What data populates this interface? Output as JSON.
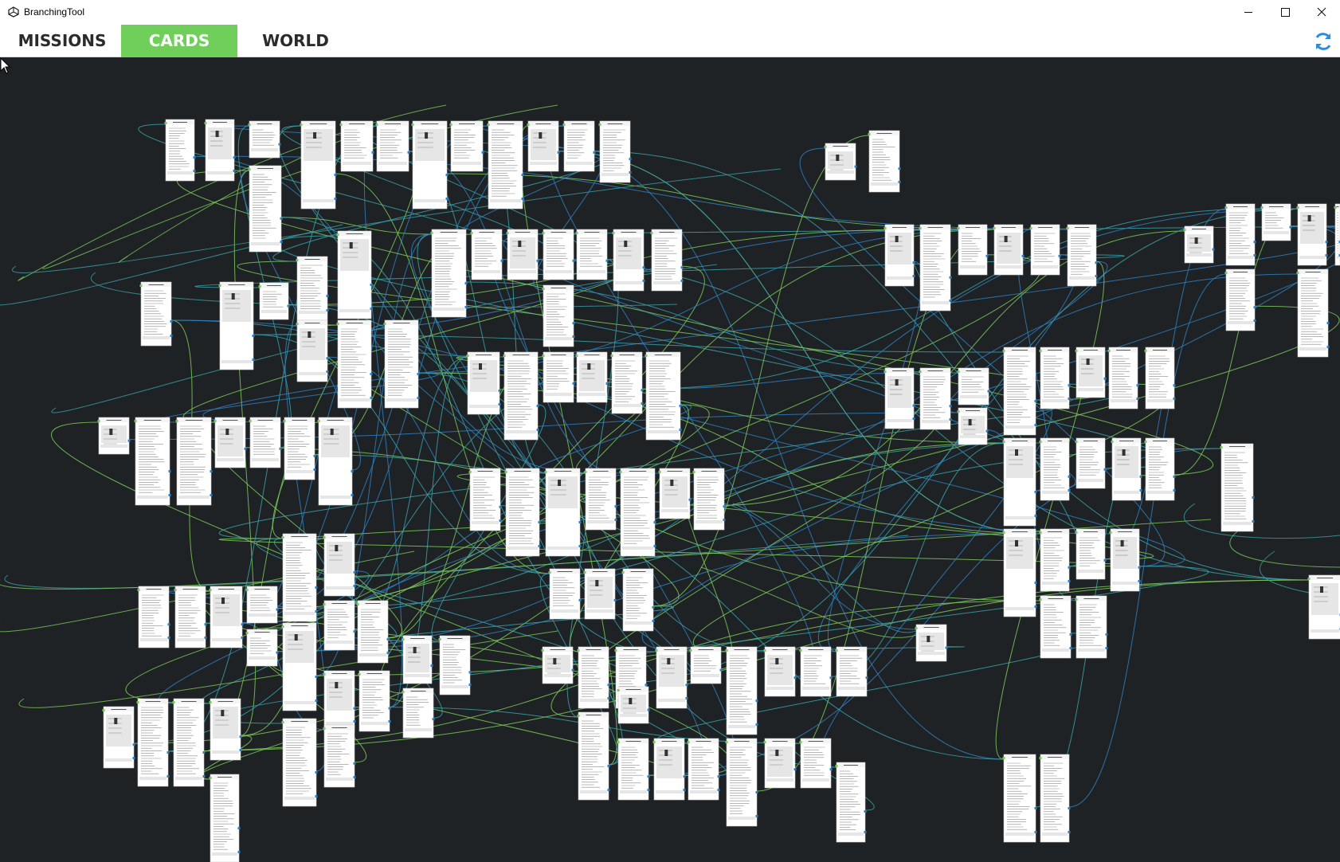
{
  "window": {
    "title": "BranchingTool"
  },
  "tabs": [
    {
      "label": "MISSIONS",
      "active": false
    },
    {
      "label": "CARDS",
      "active": true
    },
    {
      "label": "WORLD",
      "active": false
    }
  ],
  "icons": {
    "app": "unity-logo-icon",
    "minimize": "minimize-icon",
    "maximize": "maximize-icon",
    "close": "close-icon",
    "refresh": "refresh-icon",
    "cursor": "mouse-cursor-icon"
  },
  "colors": {
    "active_tab": "#6fcf5a",
    "canvas_bg": "#1f2224",
    "node_bg": "#ffffff",
    "node_field": "#e6e6e6",
    "edge_green": "#7cc95a",
    "edge_teal": "#3aa0a8",
    "edge_blue": "#2f7fc1",
    "refresh_icon": "#2a8be0"
  },
  "graph": {
    "description_visible": false
  }
}
